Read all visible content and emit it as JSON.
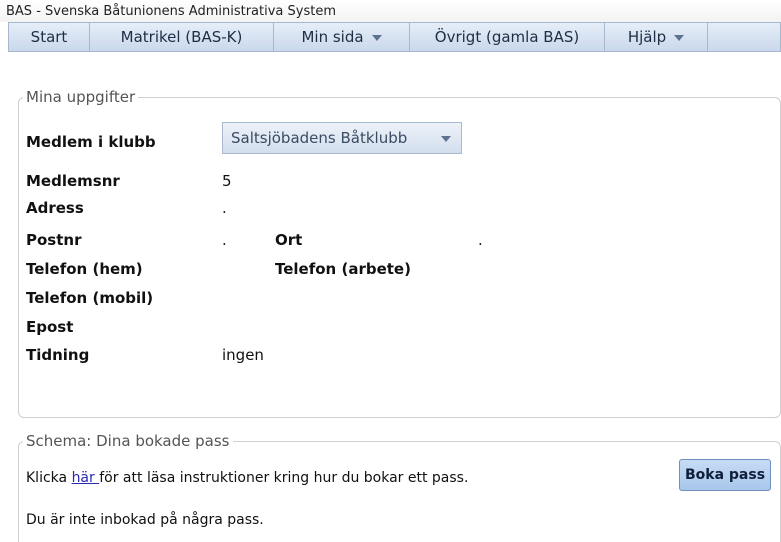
{
  "window": {
    "title": "BAS - Svenska Båtunionens Administrativa System"
  },
  "menu": {
    "items": [
      {
        "label": "Start"
      },
      {
        "label": "Matrikel (BAS-K)"
      },
      {
        "label": "Min sida",
        "has_dropdown": true
      },
      {
        "label": "Övrigt (gamla BAS)"
      },
      {
        "label": "Hjälp",
        "has_dropdown": true
      }
    ]
  },
  "info_panel": {
    "legend": "Mina uppgifter",
    "club_label": "Medlem i klubb",
    "club_selected": "Saltsjöbadens Båtklubb",
    "member_no_label": "Medlemsnr",
    "member_no_value": "5",
    "address_label": "Adress",
    "address_value": ".",
    "postcode_label": "Postnr",
    "postcode_value": ".",
    "city_label": "Ort",
    "city_value": ".",
    "phone_home_label": "Telefon (hem)",
    "phone_work_label": "Telefon (arbete)",
    "phone_mobile_label": "Telefon (mobil)",
    "email_label": "Epost",
    "newspaper_label": "Tidning",
    "newspaper_value": "ingen"
  },
  "schema_panel": {
    "legend": "Schema: Dina bokade pass",
    "instruction_before": "Klicka ",
    "instruction_link": "här ",
    "instruction_after": "för att läsa instruktioner kring hur du bokar ett pass.",
    "book_button": "Boka pass",
    "no_booking": "Du är inte inbokad på några pass."
  },
  "colors": {
    "menu_bg": "#c9d8ec",
    "button_bg": "#a9c7ec",
    "link": "#2a2ab0"
  }
}
